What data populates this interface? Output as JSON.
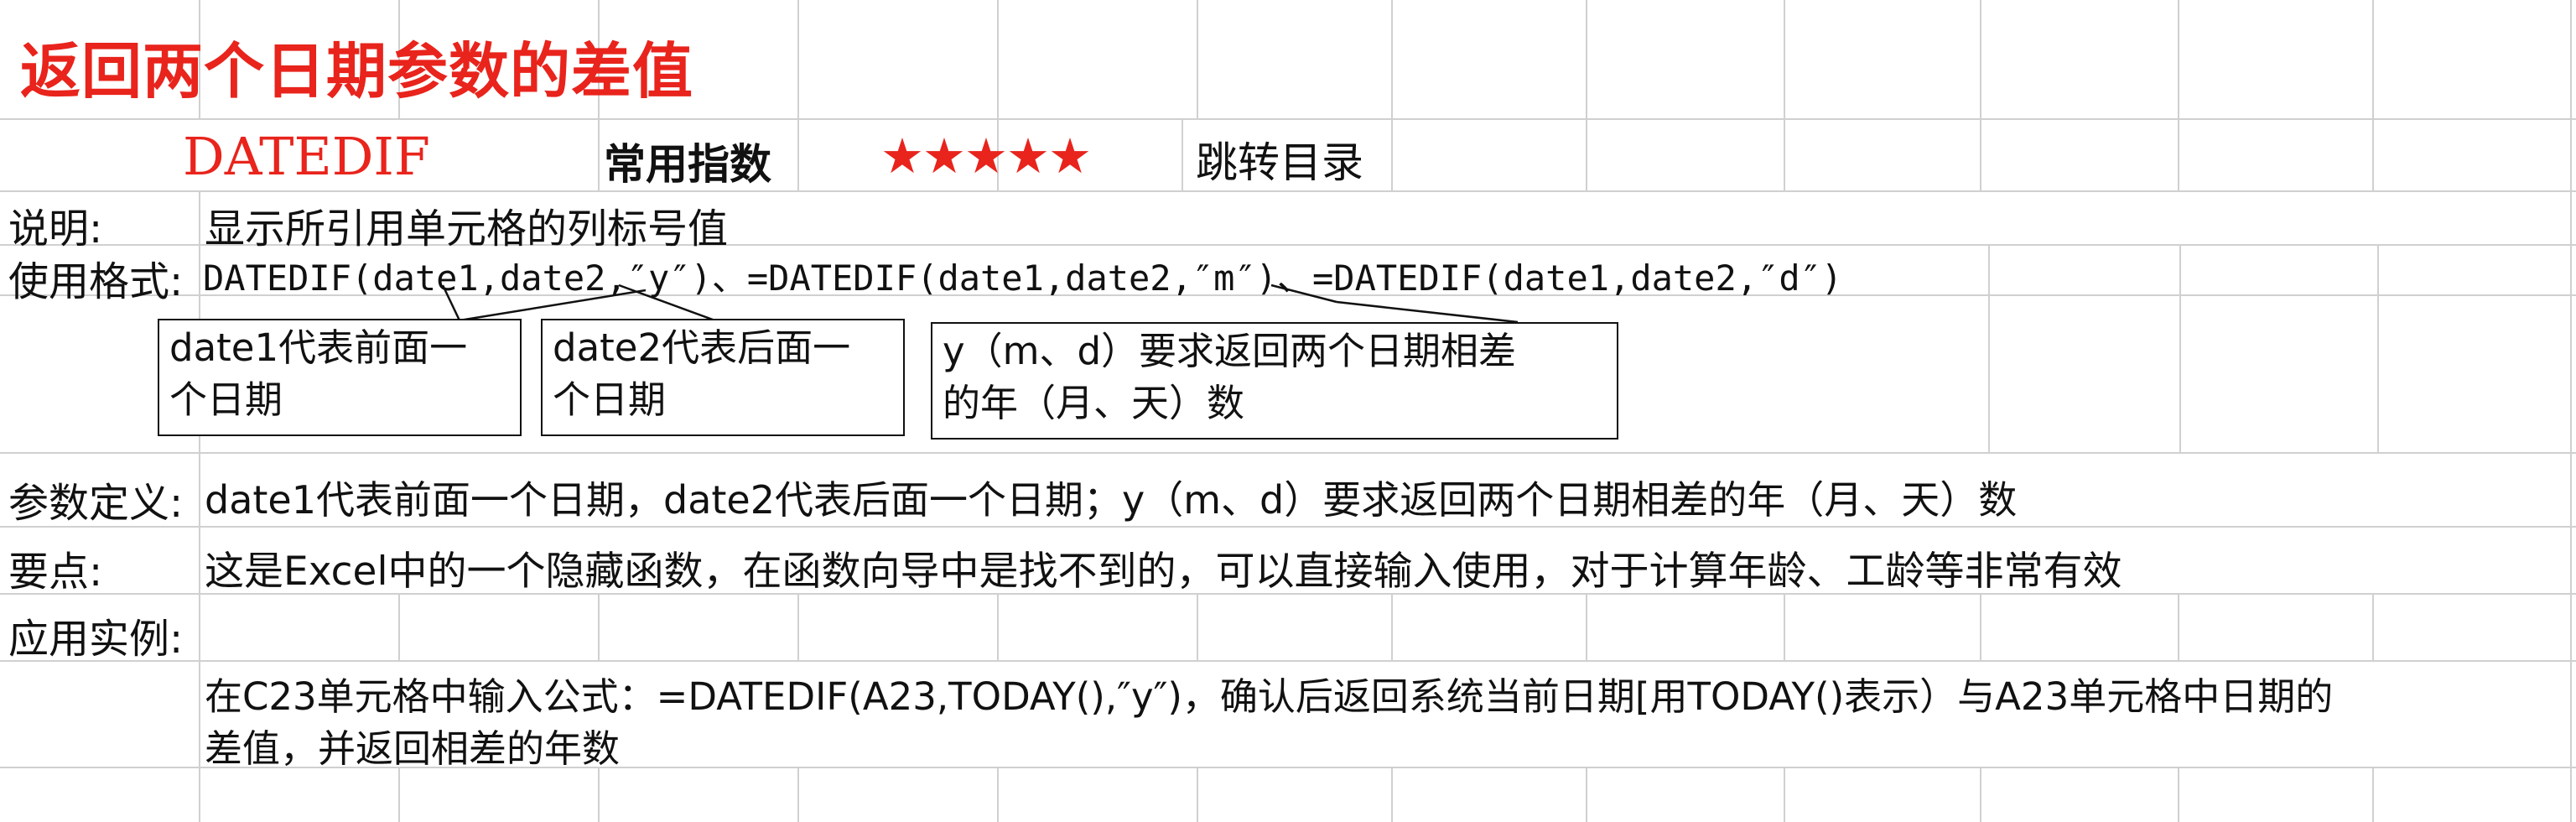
{
  "title": "返回两个日期参数的差值",
  "function_name": "DATEDIF",
  "usage_index_label": "常用指数",
  "rating": {
    "value": 5,
    "max": 5,
    "symbol": "★★★★★"
  },
  "nav_link": "跳转目录",
  "description": {
    "label": "说明:",
    "text": "显示所引用单元格的列标号值"
  },
  "format": {
    "label": "使用格式:",
    "text": "DATEDIF(date1,date2,″y″)、=DATEDIF(date1,date2,″m″)、=DATEDIF(date1,date2,″d″)"
  },
  "callouts": [
    {
      "line1": "date1代表前面一",
      "line2": "个日期"
    },
    {
      "line1": "date2代表后面一",
      "line2": "个日期"
    },
    {
      "line1": "y（m、d）要求返回两个日期相差",
      "line2": "的年（月、天）数"
    }
  ],
  "params": {
    "label": "参数定义:",
    "text": "date1代表前面一个日期，date2代表后面一个日期；y（m、d）要求返回两个日期相差的年（月、天）数"
  },
  "notes": {
    "label": "要点:",
    "text": "这是Excel中的一个隐藏函数，在函数向导中是找不到的，可以直接输入使用，对于计算年龄、工龄等非常有效"
  },
  "example": {
    "label": "应用实例:",
    "line1": "在C23单元格中输入公式：=DATEDIF(A23,TODAY(),″y″)，确认后返回系统当前日期[用TODAY()表示）与A23单元格中日期的",
    "line2": "差值，并返回相差的年数"
  }
}
